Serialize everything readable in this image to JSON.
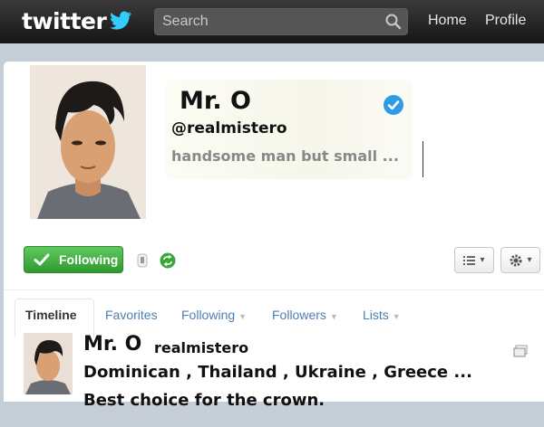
{
  "header": {
    "logo_text": "twitter",
    "search_placeholder": "Search",
    "nav": [
      "Home",
      "Profile"
    ]
  },
  "profile": {
    "name": "Mr. O",
    "handle": "@realmistero",
    "bio": "handsome man but small ...",
    "verified": true
  },
  "actions": {
    "follow_label": "Following"
  },
  "tabs": [
    {
      "label": "Timeline",
      "active": true
    },
    {
      "label": "Favorites"
    },
    {
      "label": "Following"
    },
    {
      "label": "Followers"
    },
    {
      "label": "Lists"
    }
  ],
  "tweet": {
    "name": "Mr. O",
    "handle": "realmistero",
    "line1": "Dominican , Thailand , Ukraine , Greece ...",
    "line2": "Best choice for the crown."
  },
  "colors": {
    "topbar": "#222222",
    "follow_green": "#3aa83a",
    "link_blue": "#4b7fb1",
    "verified_blue": "#2e9be6"
  }
}
